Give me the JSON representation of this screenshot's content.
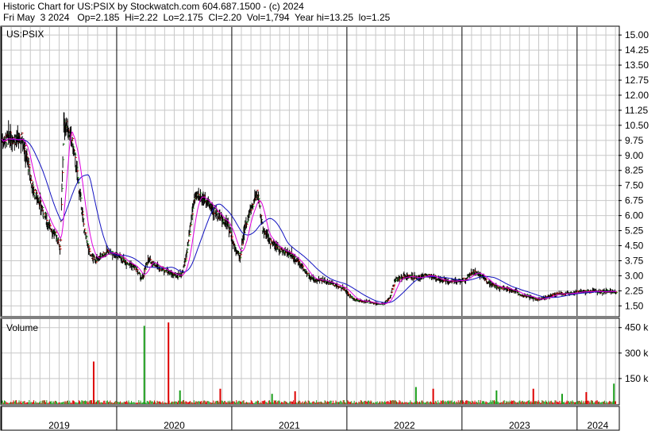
{
  "header": {
    "line1": "Historic Chart for US:PSIX by Stockwatch.com 604.687.1500 - (c) 2024",
    "line2": "Fri May  3 2024   Op=2.185  Hi=2.22  Lo=2.175  Cl=2.20  Vol=1,794  Year hi=13.25  lo=1.25"
  },
  "price_panel": {
    "symbol_label": "US:PSIX"
  },
  "volume_panel": {
    "label": "Volume"
  },
  "colors": {
    "up": "#1a9e1a",
    "down": "#dd0000",
    "ma_short": "#e000e0",
    "ma_long": "#1010c0",
    "grid": "#c8c8c8"
  },
  "chart_data": [
    {
      "type": "line",
      "title": "US:PSIX",
      "y_ticks": [
        "15.00",
        "14.25",
        "13.50",
        "12.75",
        "12.00",
        "11.25",
        "10.50",
        "9.75",
        "9.00",
        "8.25",
        "7.50",
        "6.75",
        "6.00",
        "5.25",
        "4.50",
        "3.75",
        "3.00",
        "2.25",
        "1.50"
      ],
      "ylim": [
        1.0,
        15.4
      ],
      "x_labels": [
        "2019",
        "2020",
        "2021",
        "2022",
        "2023",
        "2024"
      ],
      "xlim": [
        2019.0,
        2024.36
      ],
      "grid": true,
      "series": [
        {
          "x": [
            2019.0,
            2019.05,
            2019.1,
            2019.15,
            2019.18,
            2019.22,
            2019.27,
            2019.32,
            2019.37,
            2019.42,
            2019.47,
            2019.51,
            2019.54,
            2019.57,
            2019.62,
            2019.67,
            2019.72,
            2019.77,
            2019.82,
            2019.87,
            2019.92,
            2019.97,
            2020.02,
            2020.07,
            2020.12,
            2020.17,
            2020.22,
            2020.27,
            2020.32,
            2020.37,
            2020.42,
            2020.47,
            2020.52,
            2020.57,
            2020.62,
            2020.67,
            2020.72,
            2020.77,
            2020.82,
            2020.87,
            2020.92,
            2020.97,
            2021.02,
            2021.07,
            2021.12,
            2021.17,
            2021.22,
            2021.27,
            2021.32,
            2021.37,
            2021.42,
            2021.47,
            2021.52,
            2021.57,
            2021.62,
            2021.67,
            2021.72,
            2021.77,
            2021.82,
            2021.87,
            2021.92,
            2021.97,
            2022.02,
            2022.07,
            2022.12,
            2022.17,
            2022.22,
            2022.27,
            2022.32,
            2022.37,
            2022.42,
            2022.47,
            2022.52,
            2022.57,
            2022.62,
            2022.67,
            2022.72,
            2022.77,
            2022.82,
            2022.87,
            2022.92,
            2022.97,
            2023.02,
            2023.07,
            2023.12,
            2023.17,
            2023.22,
            2023.27,
            2023.32,
            2023.37,
            2023.42,
            2023.47,
            2023.52,
            2023.57,
            2023.62,
            2023.67,
            2023.72,
            2023.77,
            2023.82,
            2023.87,
            2023.92,
            2023.97,
            2024.02,
            2024.07,
            2024.12,
            2024.17,
            2024.22,
            2024.27,
            2024.32,
            2024.34
          ],
          "y": [
            9.8,
            9.8,
            9.9,
            9.7,
            9.9,
            8.8,
            7.3,
            6.8,
            6.0,
            5.4,
            5.0,
            4.4,
            10.5,
            10.4,
            9.5,
            7.5,
            5.2,
            4.0,
            3.8,
            4.0,
            4.2,
            4.1,
            4.0,
            3.7,
            3.6,
            3.3,
            2.8,
            3.8,
            3.6,
            3.4,
            3.3,
            3.1,
            3.0,
            3.1,
            4.5,
            6.8,
            7.0,
            6.8,
            6.4,
            6.1,
            5.8,
            5.5,
            4.5,
            3.9,
            5.6,
            6.4,
            7.2,
            5.3,
            4.8,
            4.5,
            4.3,
            4.2,
            4.0,
            3.7,
            3.4,
            2.9,
            2.8,
            2.8,
            2.7,
            2.6,
            2.5,
            2.4,
            2.0,
            1.8,
            1.75,
            1.7,
            1.65,
            1.6,
            1.6,
            1.9,
            2.8,
            2.9,
            3.0,
            2.9,
            2.9,
            3.0,
            3.0,
            2.9,
            2.8,
            2.75,
            2.7,
            2.8,
            2.8,
            3.1,
            3.2,
            3.0,
            2.7,
            2.5,
            2.4,
            2.4,
            2.3,
            2.2,
            2.0,
            2.0,
            1.9,
            1.8,
            1.9,
            2.0,
            2.1,
            2.1,
            2.1,
            2.15,
            2.2,
            2.2,
            2.2,
            2.2,
            2.2,
            2.25,
            2.2,
            2.2
          ],
          "name": ""
        }
      ]
    },
    {
      "type": "bar",
      "title": "Volume",
      "y_ticks": [
        "450 k",
        "300 k",
        "150 k"
      ],
      "ylim": [
        0,
        500
      ],
      "series": [
        {
          "x": [
            2019.8,
            2020.24,
            2020.45,
            2020.55,
            2020.9,
            2021.35,
            2021.55,
            2022.6,
            2022.75,
            2023.3,
            2023.62,
            2023.87,
            2024.08,
            2024.32
          ],
          "values": [
            250,
            460,
            480,
            80,
            90,
            60,
            75,
            100,
            90,
            80,
            90,
            60,
            70,
            120
          ],
          "name": ""
        }
      ]
    }
  ]
}
